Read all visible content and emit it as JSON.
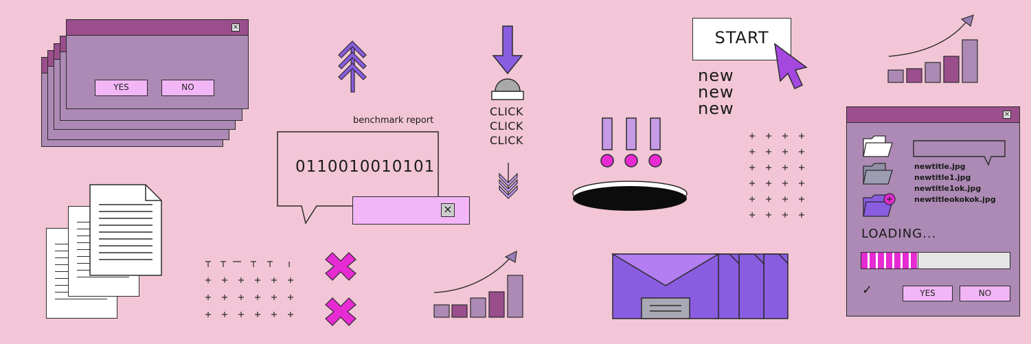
{
  "dialog": {
    "yes_label": "YES",
    "no_label": "NO",
    "close_glyph": "×"
  },
  "benchmark": {
    "title": "benchmark report",
    "binary": "0110010010101",
    "close_glyph": "×"
  },
  "click": {
    "lines": [
      "CLICK",
      "CLICK",
      "CLICK"
    ]
  },
  "start": {
    "label": "START"
  },
  "new_lines": [
    "new",
    "new",
    "new"
  ],
  "file_window": {
    "close_glyph": "×",
    "files": [
      "newtitle.jpg",
      "newtitle1.jpg",
      "newtitle1ok.jpg",
      "newtitleokokok.jpg"
    ],
    "loading_label": "LOADING...",
    "progress": 0.38,
    "yes_label": "YES",
    "no_label": "NO",
    "check_glyph": "✓"
  },
  "icons": [
    "close-icon",
    "tree-arrow-icon",
    "down-arrow-icon",
    "alarm-button-icon",
    "chevrons-down-icon",
    "exclamation-icon",
    "hole-icon",
    "cursor-icon",
    "trend-arrow-icon",
    "folder-icon",
    "folder-add-icon",
    "envelope-icon",
    "x-mark-icon",
    "document-icon"
  ],
  "colors": {
    "background": "#f2c6d6",
    "window_body": "#ad8ab5",
    "titlebar": "#9a4f8c",
    "button": "#f2b6f6",
    "accent_purple": "#8a5ce0",
    "magenta": "#e62bd2",
    "progress_fill": "#e62bd2"
  }
}
